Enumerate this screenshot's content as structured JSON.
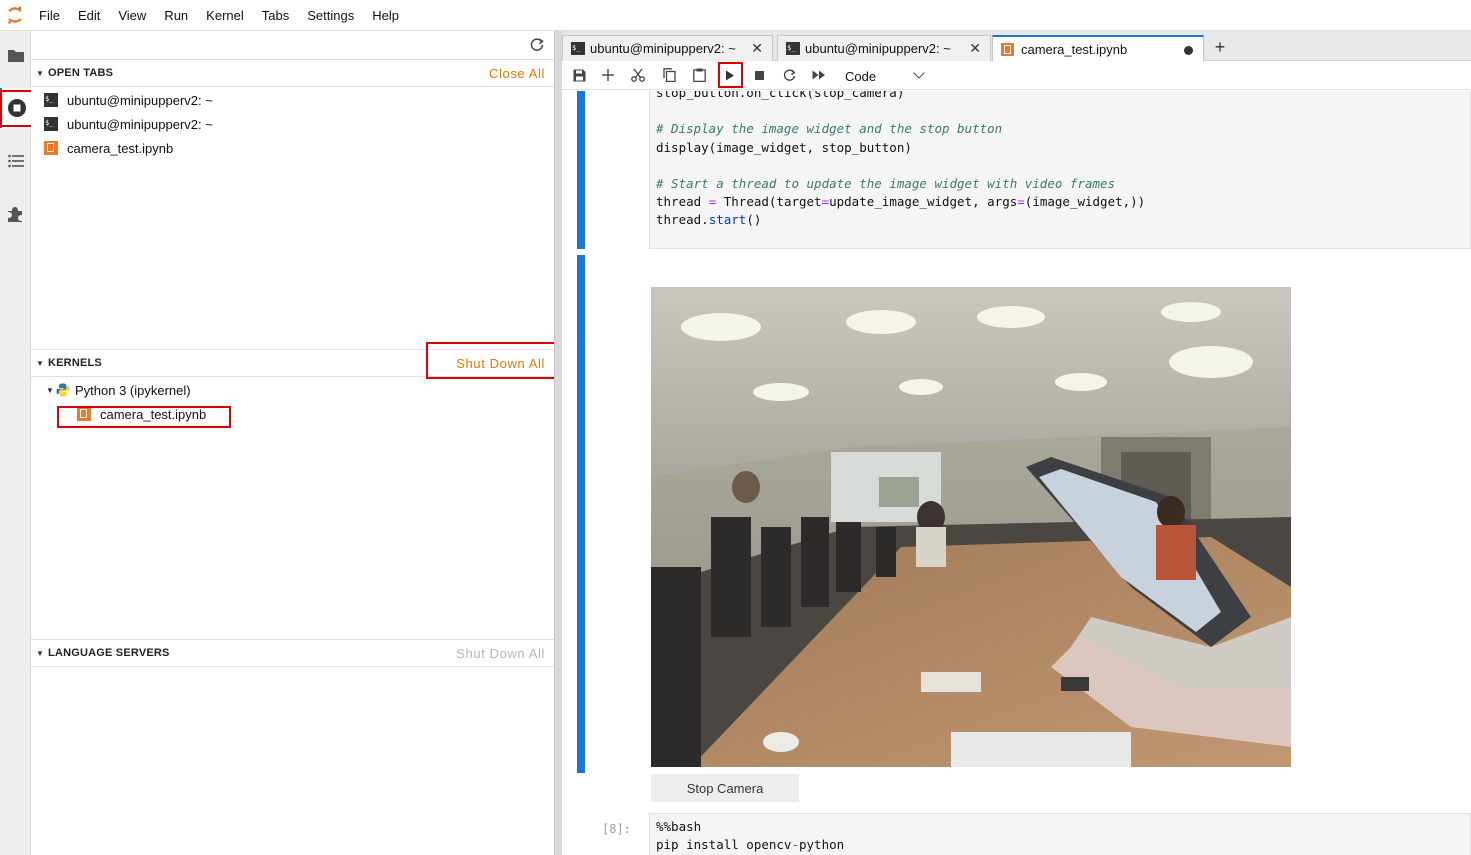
{
  "menubar": {
    "items": [
      "File",
      "Edit",
      "View",
      "Run",
      "Kernel",
      "Tabs",
      "Settings",
      "Help"
    ]
  },
  "activitybar": {
    "icons": [
      "folder-icon",
      "running-icon",
      "toc-icon",
      "extension-icon"
    ]
  },
  "sidebar": {
    "open_tabs": {
      "title": "OPEN TABS",
      "action": "Close All",
      "items": [
        {
          "icon": "terminal-icon",
          "label": "ubuntu@minipupperv2: ~"
        },
        {
          "icon": "terminal-icon",
          "label": "ubuntu@minipupperv2: ~"
        },
        {
          "icon": "notebook-icon",
          "label": "camera_test.ipynb"
        }
      ]
    },
    "kernels": {
      "title": "KERNELS",
      "action": "Shut Down All",
      "kernel_name": "Python 3 (ipykernel)",
      "kernel_session": "camera_test.ipynb"
    },
    "language_servers": {
      "title": "LANGUAGE SERVERS",
      "action": "Shut Down All"
    }
  },
  "tabs": [
    {
      "label": "ubuntu@minipupperv2: ~",
      "close": "✕"
    },
    {
      "label": "ubuntu@minipupperv2: ~",
      "close": "✕"
    },
    {
      "label": "camera_test.ipynb"
    }
  ],
  "add_tab": "+",
  "toolbar": {
    "cell_type": "Code"
  },
  "cells": {
    "cell1_lines": {
      "l0": "stop_button.on_click(stop_camera)",
      "l1": "# Display the image widget and the stop button",
      "l2": "display(image_widget, stop_button)",
      "l3": "# Start a thread to update the image widget with video frames",
      "l4a": "thread ",
      "l4b": "=",
      "l4c": " Thread(target",
      "l4d": "=",
      "l4e": "update_image_widget, args",
      "l4f": "=",
      "l4g": "(image_widget,))",
      "l5a": "thread.",
      "l5b": "start",
      "l5c": "()"
    },
    "stop_button_label": "Stop Camera",
    "cell2_prompt": "[8]:",
    "cell2_lines": {
      "l0": "%%bash",
      "l1a": "pip install opencv",
      "l1b": "-",
      "l1c": "python"
    }
  },
  "colors": {
    "accent": "#1976d2",
    "warning_action": "#e67700",
    "highlight_box": "#e00000"
  }
}
